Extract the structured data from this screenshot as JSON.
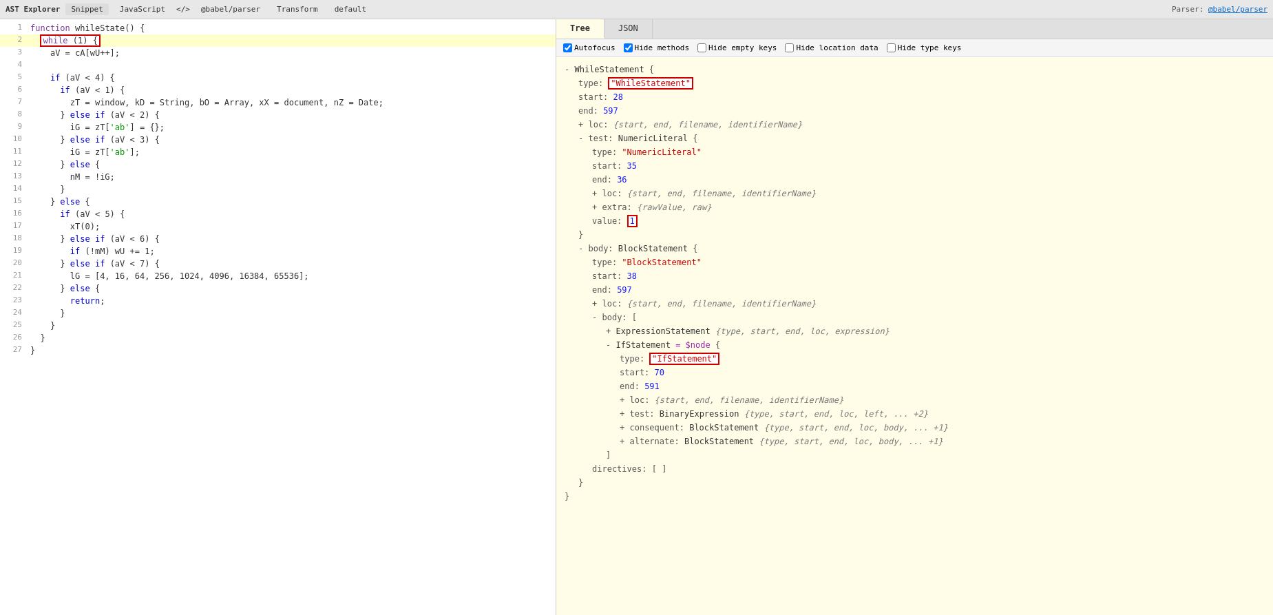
{
  "topbar": {
    "title": "AST Explorer",
    "tabs": [
      "Snippet",
      "JavaScript",
      "@babel/parser",
      "Transform",
      "default"
    ],
    "parser_label": "Parser:",
    "parser_link": "@babel/parser"
  },
  "tabs": {
    "tree_label": "Tree",
    "json_label": "JSON"
  },
  "options": {
    "autofocus_label": "Autofocus",
    "hide_methods_label": "Hide methods",
    "hide_empty_keys_label": "Hide empty keys",
    "hide_location_data_label": "Hide location data",
    "hide_type_keys_label": "Hide type keys",
    "autofocus": true,
    "hide_methods": true,
    "hide_empty_keys": false,
    "hide_location_data": false,
    "hide_type_keys": false
  },
  "code_lines": [
    {
      "num": 1,
      "text": "function whileState() {"
    },
    {
      "num": 2,
      "text": "  while (1) {",
      "highlight": true
    },
    {
      "num": 3,
      "text": "    aV = cA[wU++];"
    },
    {
      "num": 4,
      "text": ""
    },
    {
      "num": 5,
      "text": "    if (aV < 4) {"
    },
    {
      "num": 6,
      "text": "      if (aV < 1) {"
    },
    {
      "num": 7,
      "text": "        zT = window, kD = String, bO = Array, xX = document, nZ = Date;"
    },
    {
      "num": 8,
      "text": "      } else if (aV < 2) {"
    },
    {
      "num": 9,
      "text": "        iG = zT['ab'] = {};"
    },
    {
      "num": 10,
      "text": "      } else if (aV < 3) {"
    },
    {
      "num": 11,
      "text": "        iG = zT['ab'];"
    },
    {
      "num": 12,
      "text": "      } else {"
    },
    {
      "num": 13,
      "text": "        nM = !iG;"
    },
    {
      "num": 14,
      "text": "      }"
    },
    {
      "num": 15,
      "text": "    } else {"
    },
    {
      "num": 16,
      "text": "      if (aV < 5) {"
    },
    {
      "num": 17,
      "text": "        xT(0);"
    },
    {
      "num": 18,
      "text": "      } else if (aV < 6) {"
    },
    {
      "num": 19,
      "text": "        if (!mM) wU += 1;"
    },
    {
      "num": 20,
      "text": "      } else if (aV < 7) {"
    },
    {
      "num": 21,
      "text": "        lG = [4, 16, 64, 256, 1024, 4096, 16384, 65536];"
    },
    {
      "num": 22,
      "text": "      } else {"
    },
    {
      "num": 23,
      "text": "        return;"
    },
    {
      "num": 24,
      "text": "      }"
    },
    {
      "num": 25,
      "text": "    }"
    },
    {
      "num": 26,
      "text": "  }"
    },
    {
      "num": 27,
      "text": "}"
    }
  ],
  "tree": {
    "while_statement": {
      "label": "WhileStatement",
      "open_bracket": "{",
      "type_key": "type:",
      "type_value": "\"WhileStatement\"",
      "start_key": "start:",
      "start_value": "28",
      "end_key": "end:",
      "end_value": "597",
      "loc_label": "+ loc:",
      "loc_collapse": "{start, end, filename, identifierName}",
      "test_label": "- test:",
      "test_type": "NumericLiteral",
      "test_open": "{",
      "test_type_key": "type:",
      "test_type_value": "\"NumericLiteral\"",
      "test_start_key": "start:",
      "test_start_value": "35",
      "test_end_key": "end:",
      "test_end_value": "36",
      "test_loc_label": "+ loc:",
      "test_loc_collapse": "{start, end, filename, identifierName}",
      "test_extra_label": "+ extra:",
      "test_extra_collapse": "{rawValue, raw}",
      "test_value_key": "value:",
      "test_value": "1",
      "body_label": "- body:",
      "body_type": "BlockStatement",
      "body_open": "{",
      "body_type_key": "type:",
      "body_type_value": "\"BlockStatement\"",
      "body_start_key": "start:",
      "body_start_value": "38",
      "body_end_key": "end:",
      "body_end_value": "597",
      "body_loc_label": "+ loc:",
      "body_loc_collapse": "{start, end, filename, identifierName}",
      "body_body_label": "- body:",
      "body_body_open": "[",
      "expression_statement": "+ ExpressionStatement",
      "expression_collapse": "{type, start, end, loc, expression}",
      "if_statement_label": "- IfStatement",
      "if_statement_dollar": "= $node",
      "if_statement_open": "{",
      "if_type_key": "type:",
      "if_type_value": "\"IfStatement\"",
      "if_start_key": "start:",
      "if_start_value": "70",
      "if_end_key": "end:",
      "if_end_value": "591",
      "if_loc_label": "+ loc:",
      "if_loc_collapse": "{start, end, filename, identifierName}",
      "if_test_label": "+ test:",
      "if_test_type": "BinaryExpression",
      "if_test_collapse": "{type, start, end, loc, left, ... +2}",
      "if_consequent_label": "+ consequent:",
      "if_consequent_type": "BlockStatement",
      "if_consequent_collapse": "{type, start, end, loc, body, ... +1}",
      "if_alternate_label": "+ alternate:",
      "if_alternate_type": "BlockStatement",
      "if_alternate_collapse": "{type, start, end, loc, body, ... +1}",
      "if_close1": "]",
      "directives_key": "directives:",
      "directives_open": "[",
      "directives_close": "]",
      "body_close": "}",
      "while_close": "}"
    }
  }
}
